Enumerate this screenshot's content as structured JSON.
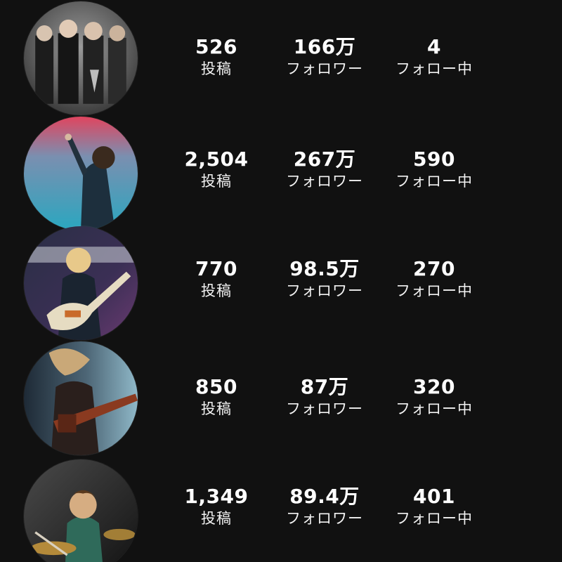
{
  "colors": {
    "background": "#111111",
    "text": "#ffffff"
  },
  "profiles": [
    {
      "avatar": "band-group-photo",
      "stats": {
        "posts": "526",
        "followers": "166万",
        "following": "4"
      },
      "labels": {
        "posts": "投稿",
        "followers": "フォロワー",
        "following": "フォロー中"
      }
    },
    {
      "avatar": "vocalist-on-stage-photo",
      "stats": {
        "posts": "2,504",
        "followers": "267万",
        "following": "590"
      },
      "labels": {
        "posts": "投稿",
        "followers": "フォロワー",
        "following": "フォロー中"
      }
    },
    {
      "avatar": "guitarist-photo",
      "stats": {
        "posts": "770",
        "followers": "98.5万",
        "following": "270"
      },
      "labels": {
        "posts": "投稿",
        "followers": "フォロワー",
        "following": "フォロー中"
      }
    },
    {
      "avatar": "bassist-photo",
      "stats": {
        "posts": "850",
        "followers": "87万",
        "following": "320"
      },
      "labels": {
        "posts": "投稿",
        "followers": "フォロワー",
        "following": "フォロー中"
      }
    },
    {
      "avatar": "drummer-photo",
      "stats": {
        "posts": "1,349",
        "followers": "89.4万",
        "following": "401"
      },
      "labels": {
        "posts": "投稿",
        "followers": "フォロワー",
        "following": "フォロー中"
      }
    }
  ]
}
